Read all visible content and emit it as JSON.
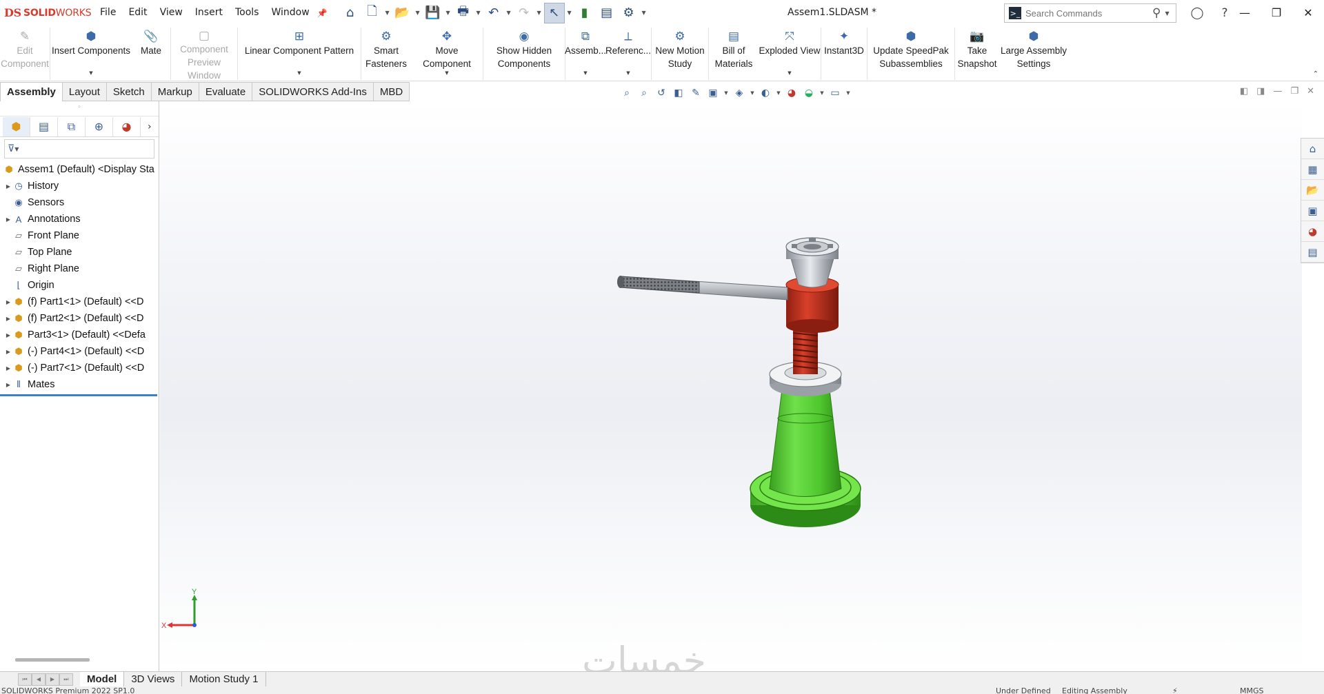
{
  "app": {
    "logo_prefix": "DS",
    "logo_bold": "SOLID",
    "logo_rest": "WORKS",
    "document_title": "Assem1.SLDASM *"
  },
  "menu": [
    "File",
    "Edit",
    "View",
    "Insert",
    "Tools",
    "Window"
  ],
  "search": {
    "placeholder": "Search Commands"
  },
  "ribbon": [
    {
      "label": "Edit\nComponent",
      "icon": "edit-component-icon",
      "disabled": true,
      "arrow": false
    },
    {
      "label": "Insert Components",
      "icon": "insert-components-icon",
      "disabled": false,
      "arrow": true
    },
    {
      "label": "Mate",
      "icon": "mate-icon",
      "disabled": false,
      "arrow": false
    },
    {
      "label": "Component\nPreview Window",
      "icon": "preview-window-icon",
      "disabled": true,
      "arrow": false
    },
    {
      "label": "Linear Component Pattern",
      "icon": "linear-pattern-icon",
      "disabled": false,
      "arrow": true
    },
    {
      "label": "Smart\nFasteners",
      "icon": "smart-fasteners-icon",
      "disabled": false,
      "arrow": false
    },
    {
      "label": "Move Component",
      "icon": "move-component-icon",
      "disabled": false,
      "arrow": true
    },
    {
      "label": "Show Hidden\nComponents",
      "icon": "show-hidden-icon",
      "disabled": false,
      "arrow": false
    },
    {
      "label": "Assemb...",
      "icon": "assembly-features-icon",
      "disabled": false,
      "arrow": true
    },
    {
      "label": "Referenc...",
      "icon": "reference-geometry-icon",
      "disabled": false,
      "arrow": true
    },
    {
      "label": "New Motion\nStudy",
      "icon": "motion-study-icon",
      "disabled": false,
      "arrow": false
    },
    {
      "label": "Bill of\nMaterials",
      "icon": "bom-icon",
      "disabled": false,
      "arrow": false
    },
    {
      "label": "Exploded View",
      "icon": "exploded-view-icon",
      "disabled": false,
      "arrow": true
    },
    {
      "label": "Instant3D",
      "icon": "instant3d-icon",
      "disabled": false,
      "arrow": false
    },
    {
      "label": "Update SpeedPak\nSubassemblies",
      "icon": "speedpak-icon",
      "disabled": false,
      "arrow": false
    },
    {
      "label": "Take\nSnapshot",
      "icon": "snapshot-icon",
      "disabled": false,
      "arrow": false
    },
    {
      "label": "Large Assembly\nSettings",
      "icon": "large-assembly-icon",
      "disabled": false,
      "arrow": false
    }
  ],
  "tabs": [
    "Assembly",
    "Layout",
    "Sketch",
    "Markup",
    "Evaluate",
    "SOLIDWORKS Add-Ins",
    "MBD"
  ],
  "tree": {
    "root": "Assem1 (Default) <Display Sta",
    "items": [
      {
        "label": "History",
        "icon": "history-icon",
        "expandable": true
      },
      {
        "label": "Sensors",
        "icon": "sensors-icon",
        "expandable": false
      },
      {
        "label": "Annotations",
        "icon": "annotations-icon",
        "expandable": true
      },
      {
        "label": "Front Plane",
        "icon": "plane-icon",
        "expandable": false
      },
      {
        "label": "Top Plane",
        "icon": "plane-icon",
        "expandable": false
      },
      {
        "label": "Right Plane",
        "icon": "plane-icon",
        "expandable": false
      },
      {
        "label": "Origin",
        "icon": "origin-icon",
        "expandable": false
      },
      {
        "label": "(f) Part1<1> (Default) <<D",
        "icon": "part-icon",
        "expandable": true
      },
      {
        "label": "(f) Part2<1> (Default) <<D",
        "icon": "part-icon",
        "expandable": true
      },
      {
        "label": "Part3<1> (Default) <<Defa",
        "icon": "part-icon",
        "expandable": true
      },
      {
        "label": "(-) Part4<1> (Default) <<D",
        "icon": "part-icon",
        "expandable": true
      },
      {
        "label": "(-) Part7<1> (Default) <<D",
        "icon": "part-icon",
        "expandable": true
      },
      {
        "label": "Mates",
        "icon": "mates-icon",
        "expandable": true
      }
    ]
  },
  "triad": {
    "x_label": "X",
    "y_label": "Y"
  },
  "watermark": "خمسات",
  "bottom_tabs": [
    "Model",
    "3D Views",
    "Motion Study 1"
  ],
  "status": {
    "left": "SOLIDWORKS Premium 2022 SP1.0",
    "middle": "Under Defined",
    "editing": "Editing Assembly",
    "units": "MMGS"
  },
  "colors": {
    "base_green": "#4fc72e",
    "nut_red": "#c8321f",
    "handle_gray": "#b8bcc2",
    "accent_blue": "#3f7fc6"
  }
}
